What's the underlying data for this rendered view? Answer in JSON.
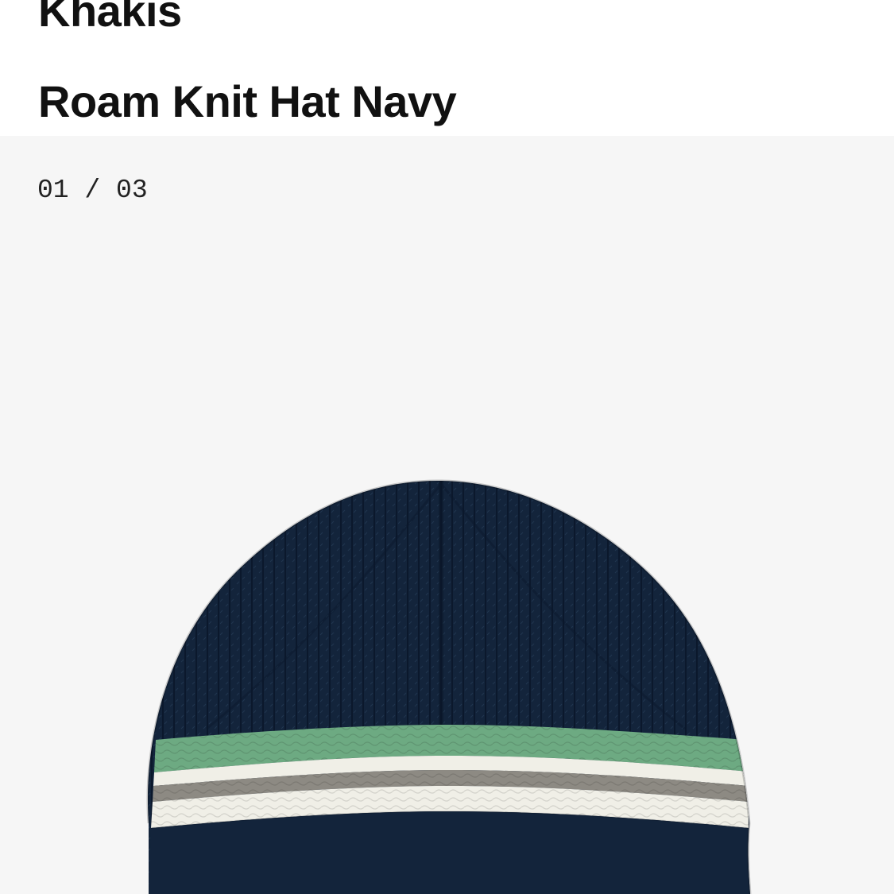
{
  "product": {
    "brand": "Khakis",
    "name": "Roam Knit Hat Navy"
  },
  "gallery": {
    "counter": "01 / 03",
    "image": {
      "subject": "knit-hat",
      "colors": {
        "background": "#f6f6f6",
        "navy": "#13243b",
        "green": "#6daa82",
        "grey": "#8d8a83",
        "cream": "#f0efe7"
      }
    }
  }
}
